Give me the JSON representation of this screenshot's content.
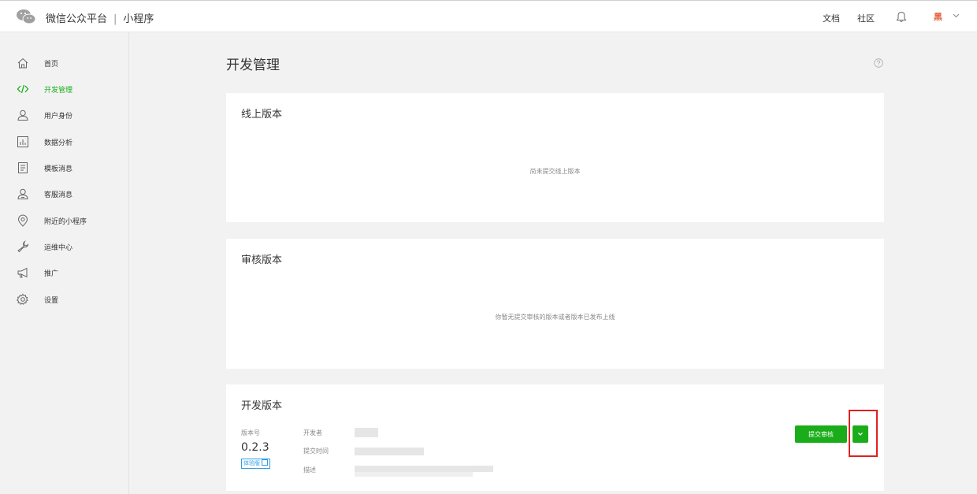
{
  "header": {
    "brand": "微信公众平台",
    "separator": "|",
    "product": "小程序",
    "links": [
      "文档",
      "社区"
    ],
    "avatar_text": "黑"
  },
  "sidebar": {
    "items": [
      {
        "label": "首页",
        "icon": "home-icon"
      },
      {
        "label": "开发管理",
        "icon": "code-icon",
        "active": true
      },
      {
        "label": "用户身份",
        "icon": "user-icon"
      },
      {
        "label": "数据分析",
        "icon": "chart-icon"
      },
      {
        "label": "模板消息",
        "icon": "document-icon"
      },
      {
        "label": "客服消息",
        "icon": "support-icon"
      },
      {
        "label": "附近的小程序",
        "icon": "location-icon"
      },
      {
        "label": "运维中心",
        "icon": "wrench-icon"
      },
      {
        "label": "推广",
        "icon": "megaphone-icon"
      },
      {
        "label": "设置",
        "icon": "gear-icon"
      }
    ]
  },
  "main": {
    "title": "开发管理",
    "online": {
      "title": "线上版本",
      "empty": "尚未提交线上版本"
    },
    "review": {
      "title": "审核版本",
      "empty": "你暂无提交审核的版本或者版本已发布上线"
    },
    "dev": {
      "title": "开发版本",
      "version_label": "版本号",
      "version": "0.2.3",
      "badge": "体验版",
      "developer_label": "开发者",
      "time_label": "提交时间",
      "desc_label": "描述",
      "submit_button": "提交审核"
    }
  },
  "colors": {
    "accent": "#1aad19",
    "highlight": "#e02020",
    "badge": "#2e9fe6"
  }
}
